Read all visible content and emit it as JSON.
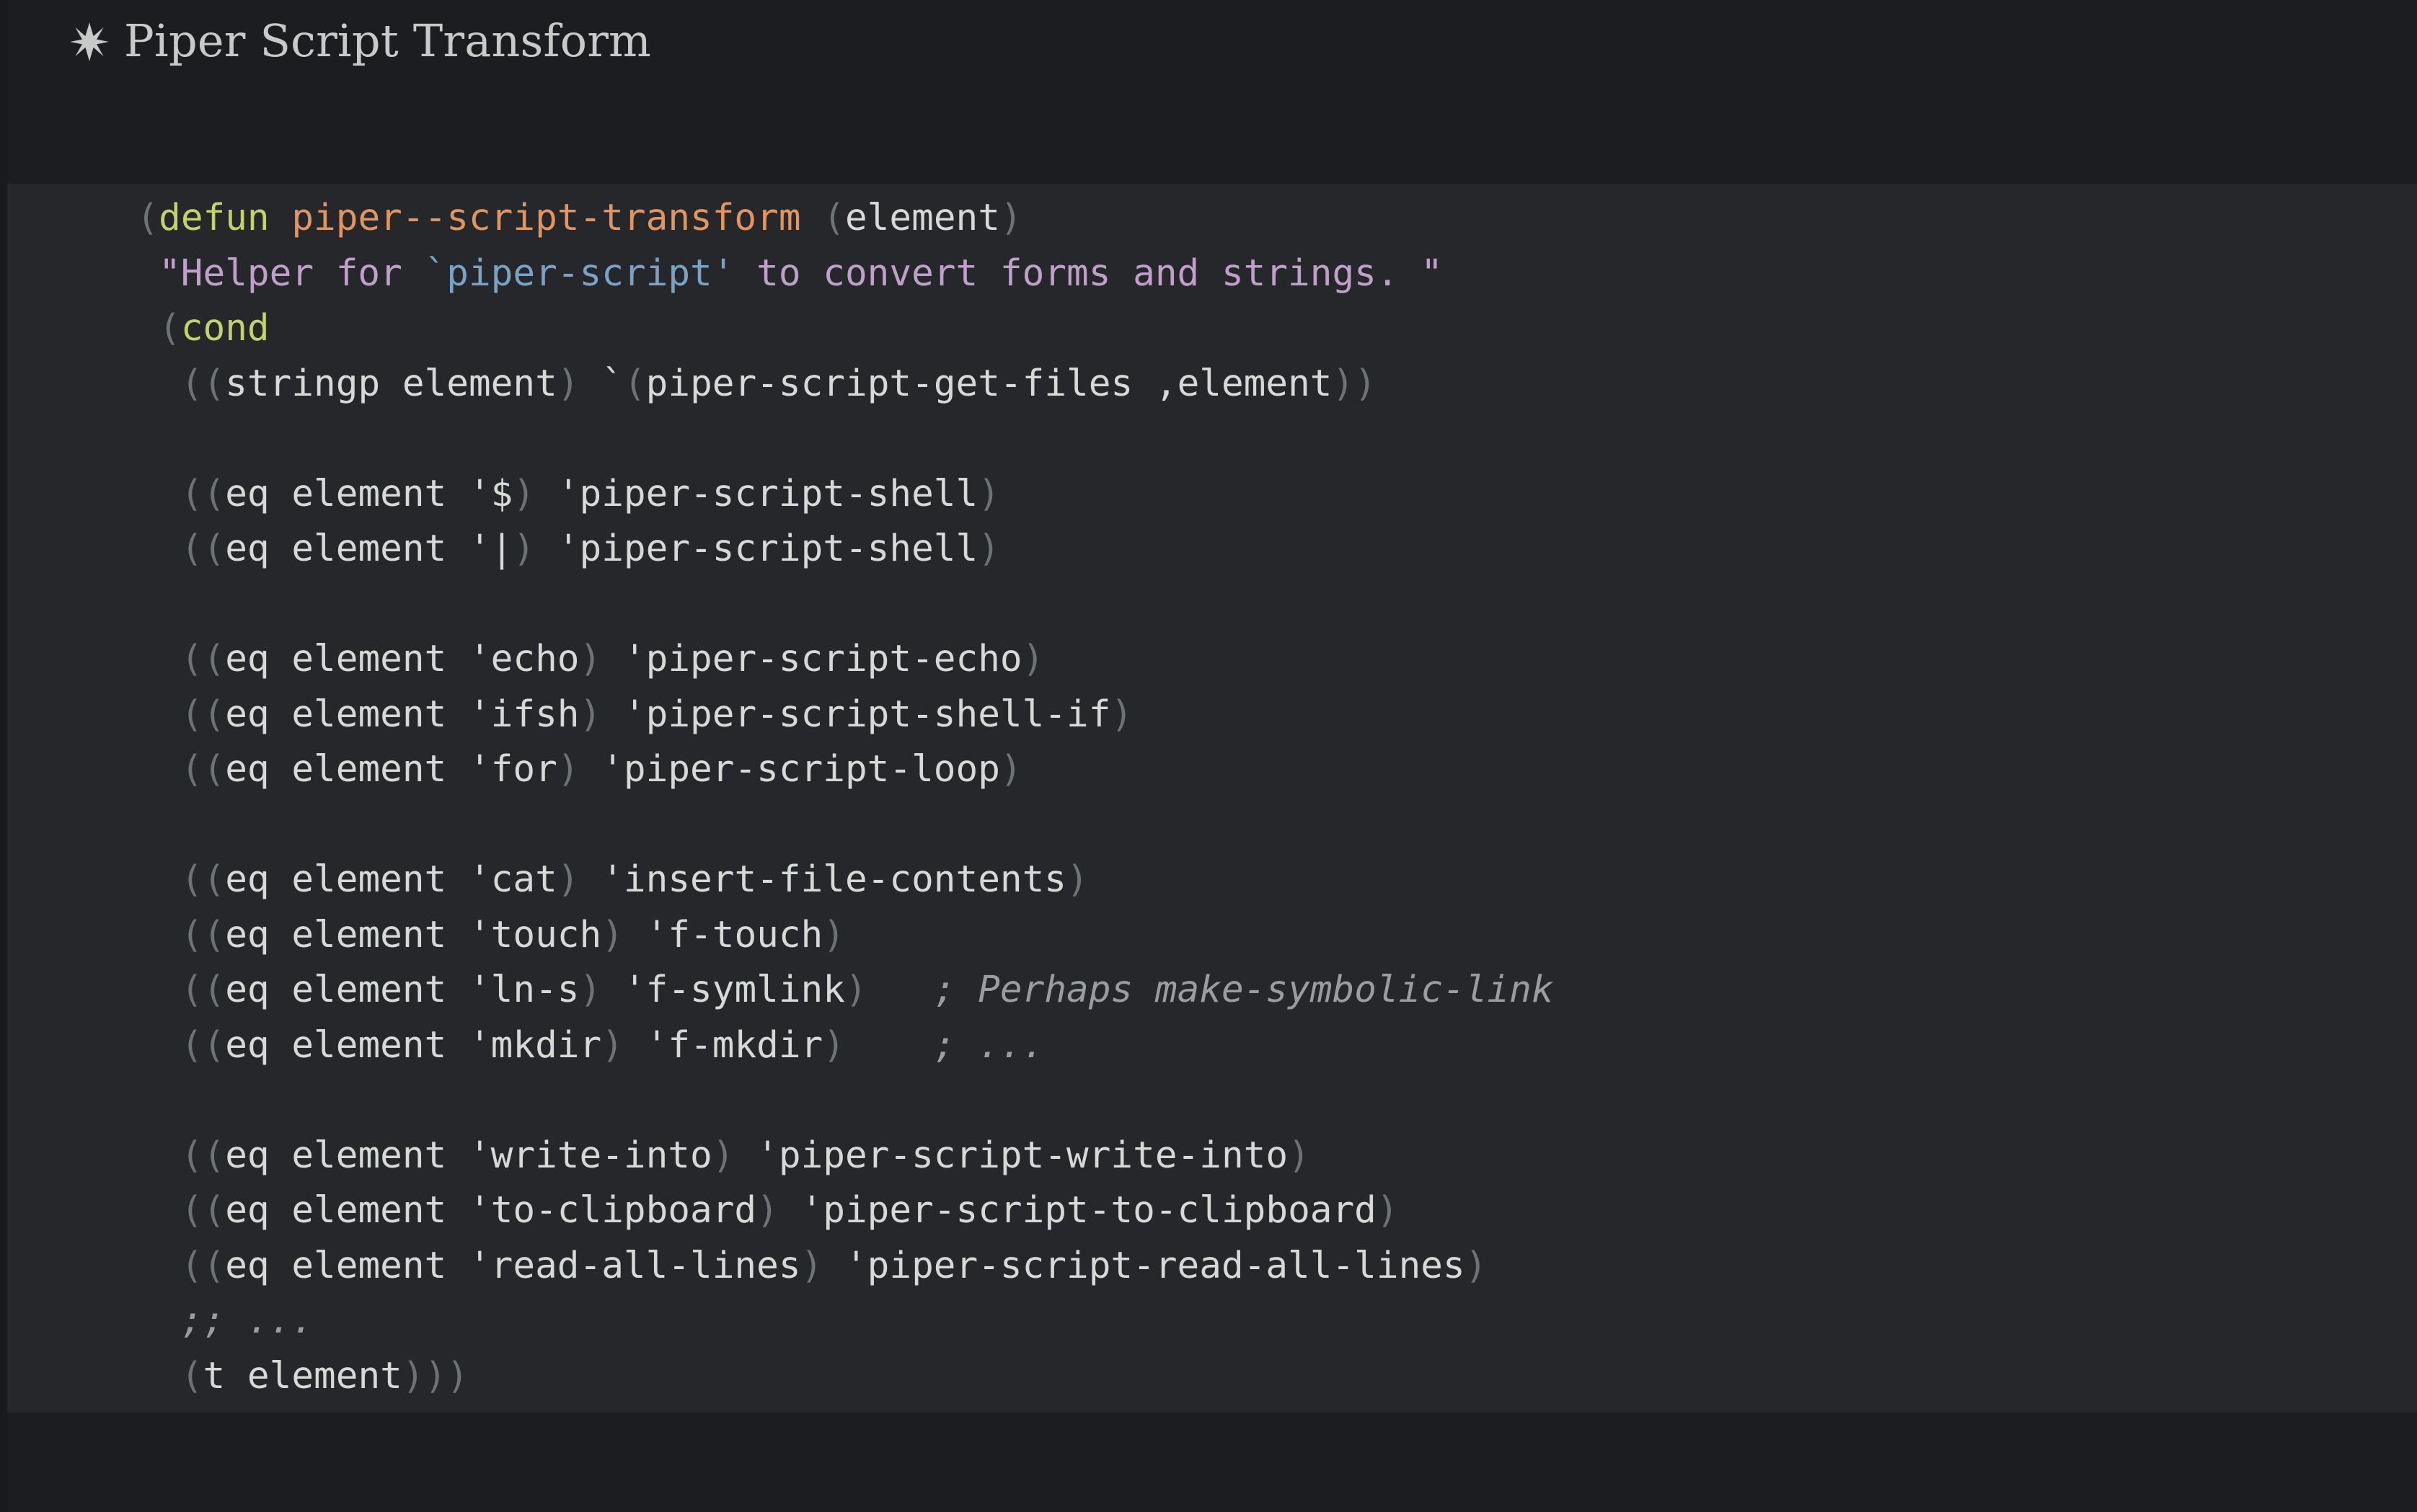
{
  "header": {
    "bullet_icon": "asterisk-star-icon",
    "title": "Piper Script Transform"
  },
  "colors": {
    "header_background": "#1c1d20",
    "code_background": "#25272a",
    "footer_background": "#1c1d20",
    "title_text": "#c8cac9",
    "code_text": "#d6dad7",
    "keyword": "#c3d36a",
    "function_name": "#e2955e",
    "string": "#c0a0cb",
    "string_reference": "#7aa2c4",
    "paren": "#6d7275",
    "comment": "#9a9d9e"
  },
  "code_block": {
    "language": "emacs-lisp",
    "lines": [
      {
        "indent": 2,
        "segments": [
          {
            "text": "(",
            "cls": "t-paren"
          },
          {
            "text": "defun ",
            "cls": "t-kw"
          },
          {
            "text": "piper--script-transform",
            "cls": "t-fname"
          },
          {
            "text": " ",
            "cls": "t-txt"
          },
          {
            "text": "(",
            "cls": "t-paren"
          },
          {
            "text": "element",
            "cls": "t-txt"
          },
          {
            "text": ")",
            "cls": "t-paren"
          }
        ]
      },
      {
        "indent": 3,
        "segments": [
          {
            "text": "\"Helper for ",
            "cls": "t-str"
          },
          {
            "text": "`piper-script'",
            "cls": "t-strref"
          },
          {
            "text": " to convert forms and strings. \"",
            "cls": "t-str"
          }
        ]
      },
      {
        "indent": 3,
        "segments": [
          {
            "text": "(",
            "cls": "t-paren"
          },
          {
            "text": "cond",
            "cls": "t-kw"
          }
        ]
      },
      {
        "indent": 4,
        "segments": [
          {
            "text": "((",
            "cls": "t-paren"
          },
          {
            "text": "stringp element",
            "cls": "t-txt"
          },
          {
            "text": ")",
            "cls": "t-paren"
          },
          {
            "text": " `",
            "cls": "t-txt"
          },
          {
            "text": "(",
            "cls": "t-paren"
          },
          {
            "text": "piper-script-get-files ,element",
            "cls": "t-txt"
          },
          {
            "text": "))",
            "cls": "t-paren"
          }
        ]
      },
      {
        "blank": true
      },
      {
        "indent": 4,
        "segments": [
          {
            "text": "((",
            "cls": "t-paren"
          },
          {
            "text": "eq element '$",
            "cls": "t-txt"
          },
          {
            "text": ")",
            "cls": "t-paren"
          },
          {
            "text": " 'piper-script-shell",
            "cls": "t-txt"
          },
          {
            "text": ")",
            "cls": "t-paren"
          }
        ]
      },
      {
        "indent": 4,
        "segments": [
          {
            "text": "((",
            "cls": "t-paren"
          },
          {
            "text": "eq element '|",
            "cls": "t-txt"
          },
          {
            "text": ")",
            "cls": "t-paren"
          },
          {
            "text": " 'piper-script-shell",
            "cls": "t-txt"
          },
          {
            "text": ")",
            "cls": "t-paren"
          }
        ]
      },
      {
        "blank": true
      },
      {
        "indent": 4,
        "segments": [
          {
            "text": "((",
            "cls": "t-paren"
          },
          {
            "text": "eq element 'echo",
            "cls": "t-txt"
          },
          {
            "text": ")",
            "cls": "t-paren"
          },
          {
            "text": " 'piper-script-echo",
            "cls": "t-txt"
          },
          {
            "text": ")",
            "cls": "t-paren"
          }
        ]
      },
      {
        "indent": 4,
        "segments": [
          {
            "text": "((",
            "cls": "t-paren"
          },
          {
            "text": "eq element 'ifsh",
            "cls": "t-txt"
          },
          {
            "text": ")",
            "cls": "t-paren"
          },
          {
            "text": " 'piper-script-shell-if",
            "cls": "t-txt"
          },
          {
            "text": ")",
            "cls": "t-paren"
          }
        ]
      },
      {
        "indent": 4,
        "segments": [
          {
            "text": "((",
            "cls": "t-paren"
          },
          {
            "text": "eq element 'for",
            "cls": "t-txt"
          },
          {
            "text": ")",
            "cls": "t-paren"
          },
          {
            "text": " 'piper-script-loop",
            "cls": "t-txt"
          },
          {
            "text": ")",
            "cls": "t-paren"
          }
        ]
      },
      {
        "blank": true
      },
      {
        "indent": 4,
        "segments": [
          {
            "text": "((",
            "cls": "t-paren"
          },
          {
            "text": "eq element 'cat",
            "cls": "t-txt"
          },
          {
            "text": ")",
            "cls": "t-paren"
          },
          {
            "text": " 'insert-file-contents",
            "cls": "t-txt"
          },
          {
            "text": ")",
            "cls": "t-paren"
          }
        ]
      },
      {
        "indent": 4,
        "segments": [
          {
            "text": "((",
            "cls": "t-paren"
          },
          {
            "text": "eq element 'touch",
            "cls": "t-txt"
          },
          {
            "text": ")",
            "cls": "t-paren"
          },
          {
            "text": " 'f-touch",
            "cls": "t-txt"
          },
          {
            "text": ")",
            "cls": "t-paren"
          }
        ]
      },
      {
        "indent": 4,
        "segments": [
          {
            "text": "((",
            "cls": "t-paren"
          },
          {
            "text": "eq element 'ln-s",
            "cls": "t-txt"
          },
          {
            "text": ")",
            "cls": "t-paren"
          },
          {
            "text": " 'f-symlink",
            "cls": "t-txt"
          },
          {
            "text": ")",
            "cls": "t-paren"
          },
          {
            "text": "   ; Perhaps make-symbolic-link",
            "cls": "t-cmt"
          }
        ]
      },
      {
        "indent": 4,
        "segments": [
          {
            "text": "((",
            "cls": "t-paren"
          },
          {
            "text": "eq element 'mkdir",
            "cls": "t-txt"
          },
          {
            "text": ")",
            "cls": "t-paren"
          },
          {
            "text": " 'f-mkdir",
            "cls": "t-txt"
          },
          {
            "text": ")",
            "cls": "t-paren"
          },
          {
            "text": "    ; ...",
            "cls": "t-cmt"
          }
        ]
      },
      {
        "blank": true
      },
      {
        "indent": 4,
        "segments": [
          {
            "text": "((",
            "cls": "t-paren"
          },
          {
            "text": "eq element 'write-into",
            "cls": "t-txt"
          },
          {
            "text": ")",
            "cls": "t-paren"
          },
          {
            "text": " 'piper-script-write-into",
            "cls": "t-txt"
          },
          {
            "text": ")",
            "cls": "t-paren"
          }
        ]
      },
      {
        "indent": 4,
        "segments": [
          {
            "text": "((",
            "cls": "t-paren"
          },
          {
            "text": "eq element 'to-clipboard",
            "cls": "t-txt"
          },
          {
            "text": ")",
            "cls": "t-paren"
          },
          {
            "text": " 'piper-script-to-clipboard",
            "cls": "t-txt"
          },
          {
            "text": ")",
            "cls": "t-paren"
          }
        ]
      },
      {
        "indent": 4,
        "segments": [
          {
            "text": "((",
            "cls": "t-paren"
          },
          {
            "text": "eq element 'read-all-lines",
            "cls": "t-txt"
          },
          {
            "text": ")",
            "cls": "t-paren"
          },
          {
            "text": " 'piper-script-read-all-lines",
            "cls": "t-txt"
          },
          {
            "text": ")",
            "cls": "t-paren"
          }
        ]
      },
      {
        "indent": 4,
        "segments": [
          {
            "text": ";; ...",
            "cls": "t-cmt"
          }
        ]
      },
      {
        "indent": 4,
        "segments": [
          {
            "text": "(",
            "cls": "t-paren"
          },
          {
            "text": "t element",
            "cls": "t-txt"
          },
          {
            "text": ")))",
            "cls": "t-paren"
          }
        ]
      }
    ]
  }
}
